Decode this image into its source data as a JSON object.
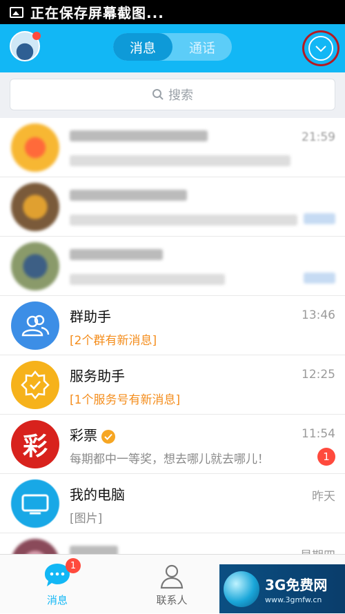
{
  "status_bar": {
    "text": "正在保存屏幕截图..."
  },
  "header": {
    "tabs": [
      {
        "label": "消息",
        "active": true
      },
      {
        "label": "通话",
        "active": false
      }
    ],
    "dropdown_icon": "chevron-down-circle-icon"
  },
  "search": {
    "placeholder": "搜索"
  },
  "conversations": [
    {
      "name": "",
      "preview": "",
      "time": "21:59",
      "blurred": true,
      "avatar_color": "#f4a020"
    },
    {
      "name": "",
      "preview": "",
      "time": "",
      "blurred": true,
      "avatar_color": "#c38a3a"
    },
    {
      "name": "",
      "preview": "",
      "time": "",
      "blurred": true,
      "avatar_color": "#6b7b5a"
    },
    {
      "name": "群助手",
      "preview": "[2个群有新消息]",
      "time": "13:46",
      "avatar_color": "#3c8ee6",
      "icon": "group-icon"
    },
    {
      "name": "服务助手",
      "preview": "[1个服务号有新消息]",
      "time": "12:25",
      "avatar_color": "#f6b21b",
      "icon": "service-badge-icon"
    },
    {
      "name": "彩票",
      "preview": "每期都中一等奖，想去哪儿就去哪儿！",
      "time": "11:54",
      "unread": "1",
      "avatar_color": "#d8221d",
      "avatar_text": "彩",
      "verified": true
    },
    {
      "name": "我的电脑",
      "preview": "[图片]",
      "time": "昨天",
      "avatar_color": "#18a8e6",
      "icon": "computer-icon"
    },
    {
      "name": "",
      "preview": "",
      "time": "星期四",
      "blurred": true,
      "avatar_color": "#b06a7a"
    }
  ],
  "tabbar": {
    "items": [
      {
        "label": "消息",
        "badge": "1",
        "icon": "chat-bubble-icon"
      },
      {
        "label": "联系人",
        "icon": "contact-icon"
      }
    ]
  },
  "watermark": {
    "title": "3G免费网",
    "url": "www.3gmfw.cn"
  }
}
